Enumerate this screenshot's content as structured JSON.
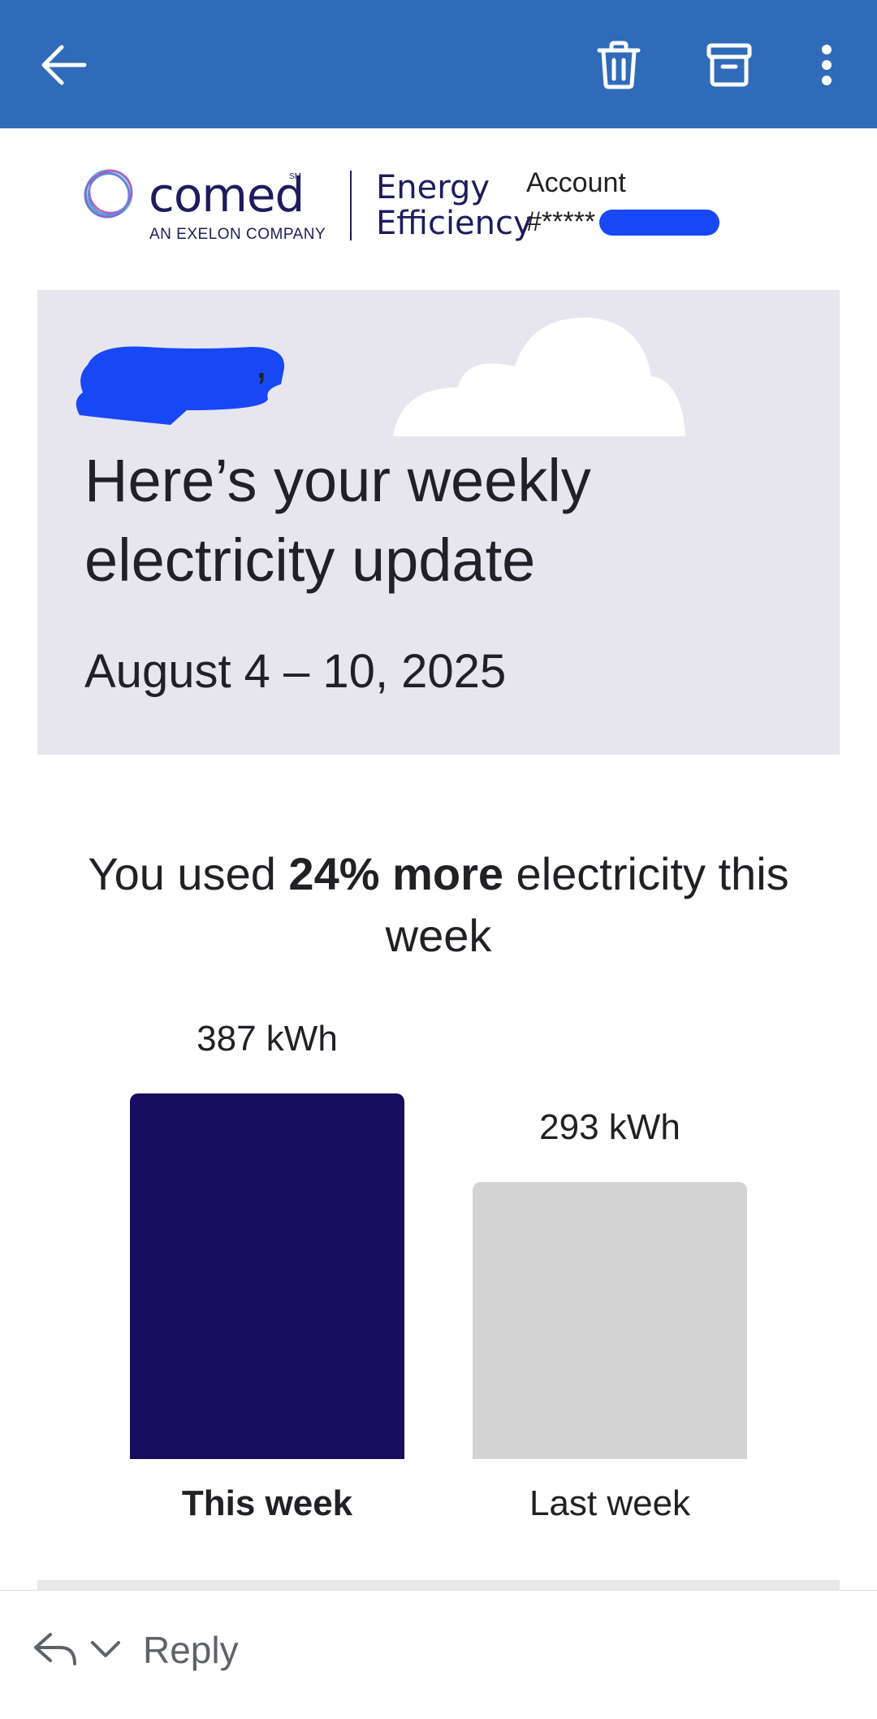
{
  "toolbar": {
    "back_icon": "back-arrow-icon",
    "delete_icon": "trash-icon",
    "archive_icon": "archive-icon",
    "more_icon": "more-vert-icon",
    "bar_color": "#2f6bb8"
  },
  "brand": {
    "logo_text": "comed",
    "logo_trademark": "SM",
    "logo_subtitle": "AN EXELON COMPANY",
    "program_line1": "Energy",
    "program_line2": "Efficiency",
    "account_label": "Account",
    "account_number": "#*****"
  },
  "hero": {
    "greeting_suffix": ",",
    "title": "Here’s your weekly electricity update",
    "date_range": "August 4 – 10, 2025"
  },
  "usage": {
    "headline_pre": "You used ",
    "headline_bold": "24% more",
    "headline_post": " electricity this week"
  },
  "chart_data": {
    "type": "bar",
    "categories": [
      "This week",
      "Last week"
    ],
    "values": [
      387,
      293
    ],
    "unit": "kWh",
    "value_labels": [
      "387 kWh",
      "293 kWh"
    ],
    "colors": [
      "#170c5e",
      "#d3d3d3"
    ],
    "emphasized_category": "This week"
  },
  "reply": {
    "label": "Reply",
    "icon": "reply-icon",
    "chevron": "chevron-down-icon"
  }
}
